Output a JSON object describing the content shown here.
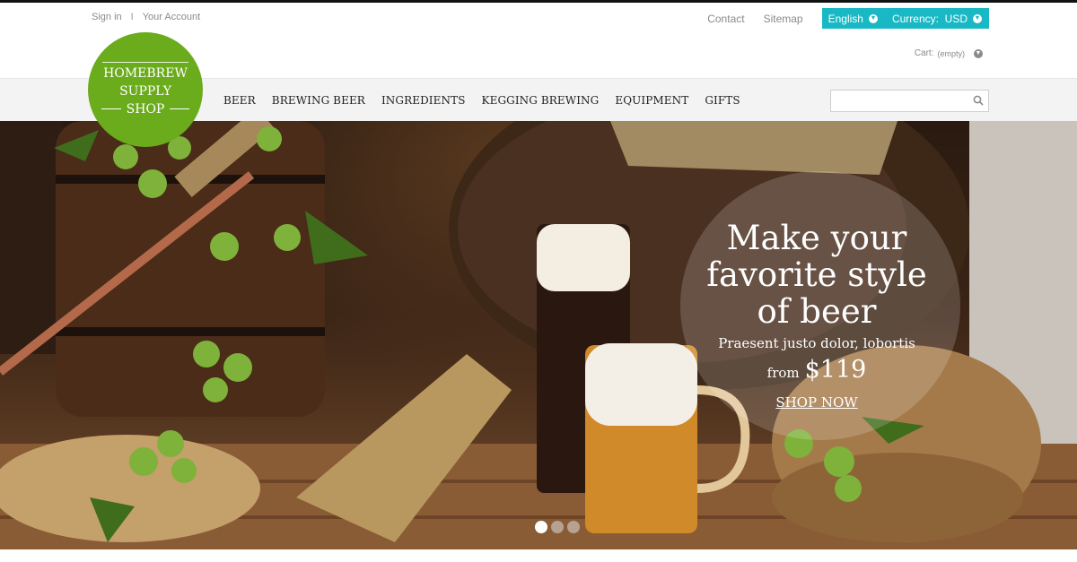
{
  "header": {
    "sign_in": "Sign in",
    "separator": "I",
    "account": "Your Account",
    "contact": "Contact",
    "sitemap": "Sitemap",
    "language": "English",
    "currency": "Currency:  USD",
    "cart_label": "Cart:",
    "cart_status": "(empty)"
  },
  "logo": {
    "line1": "HOMEBREW",
    "line2": "SUPPLY",
    "line3": "SHOP"
  },
  "nav": {
    "items": [
      "BEER",
      "BREWING BEER",
      "INGREDIENTS",
      "KEGGING BREWING",
      "EQUIPMENT",
      "GIFTS"
    ]
  },
  "search": {
    "placeholder": ""
  },
  "hero": {
    "headline_1": "Make your",
    "headline_2": "favorite style",
    "headline_3": "of beer",
    "subtitle": "Praesent justo dolor, lobortis",
    "from": "from",
    "price": "$119",
    "cta": "SHOP NOW",
    "slides_total": 3,
    "active_slide": 1
  },
  "colors": {
    "accent": "#18b8c4",
    "logo_green": "#6aac1c",
    "nav_bg": "#f3f3f3"
  }
}
